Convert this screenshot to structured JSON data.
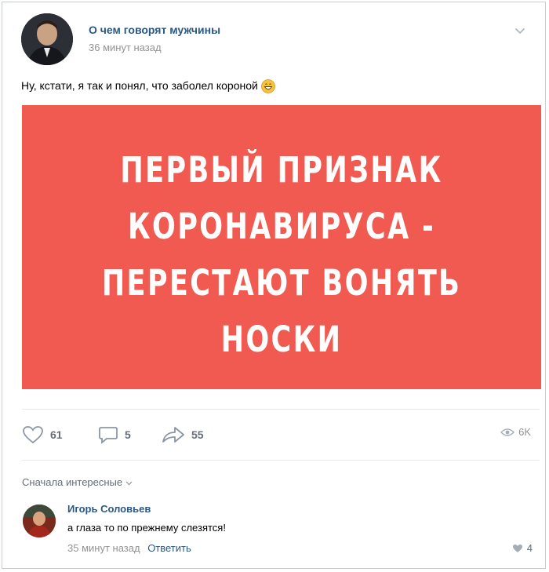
{
  "post": {
    "group_name": "О чем говорят мужчины",
    "time": "36 минут назад",
    "text": "Ну, кстати, я так и понял, что заболел короной",
    "emoji": "grinning-emoji",
    "banner": {
      "color": "#f05a51",
      "lines": [
        "ПЕРВЫЙ ПРИЗНАК",
        "КОРОНАВИРУСА -",
        "ПЕРЕСТАЮТ ВОНЯТЬ",
        "НОСКИ"
      ]
    }
  },
  "actions": {
    "likes": "61",
    "comments": "5",
    "shares": "55",
    "views": "6K"
  },
  "comments": {
    "sort_label": "Сначала интересные",
    "items": [
      {
        "author": "Игорь Соловьев",
        "text": "а глаза то по прежнему слезятся!",
        "time": "35 минут назад",
        "reply_label": "Ответить",
        "likes": "4"
      }
    ]
  },
  "colors": {
    "link": "#2a5885",
    "muted": "#939393",
    "accent": "#f05a51"
  }
}
